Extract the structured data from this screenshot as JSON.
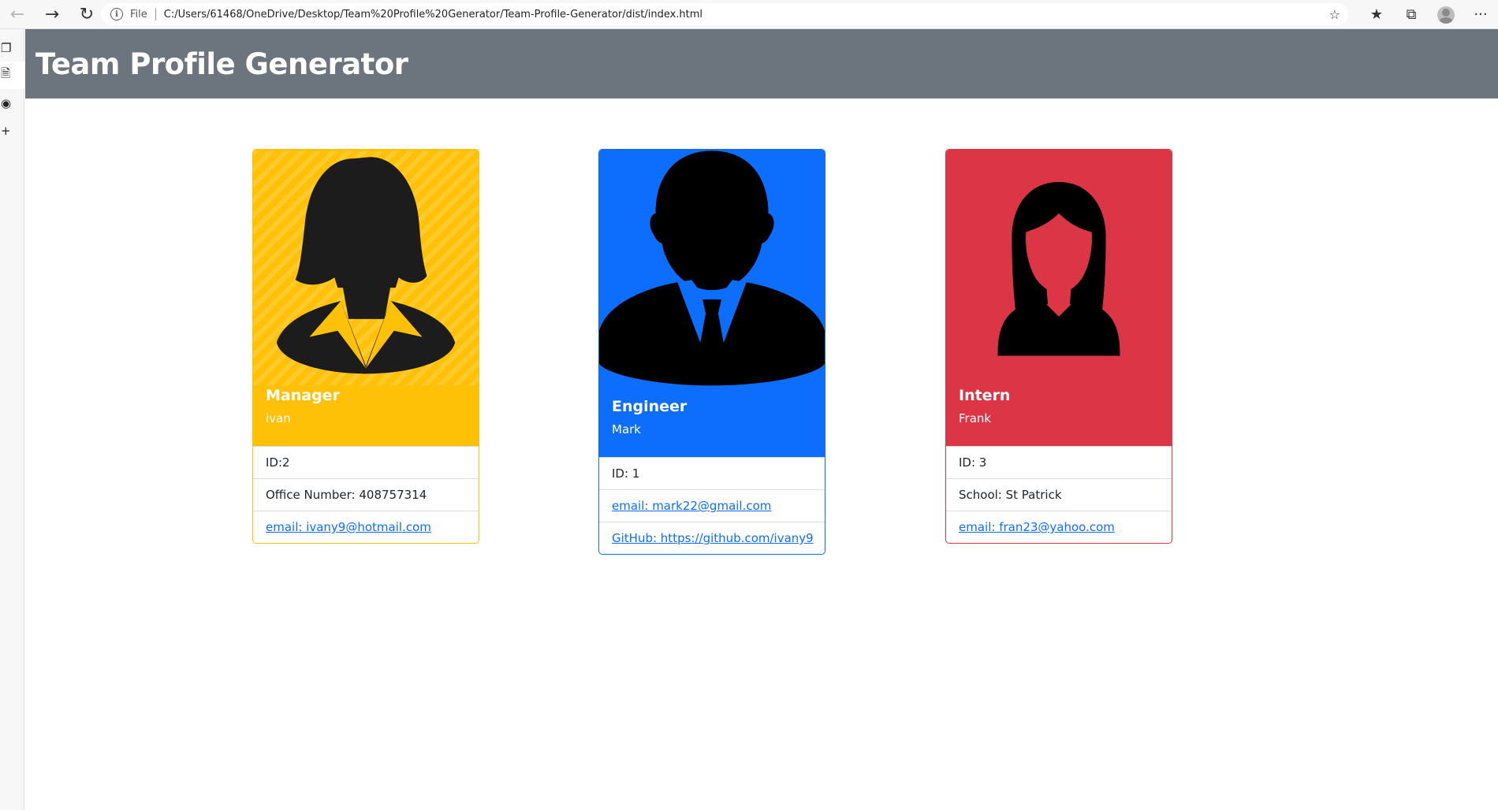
{
  "browser": {
    "file_label": "File",
    "url": "C:/Users/61468/OneDrive/Desktop/Team%20Profile%20Generator/Team-Profile-Generator/dist/index.html",
    "menu_glyph": "···"
  },
  "header": {
    "title": "Team Profile Generator"
  },
  "colors": {
    "manager": "#ffc107",
    "engineer": "#0d6efd",
    "intern": "#dc3545",
    "header": "#6c757d"
  },
  "cards": [
    {
      "role": "Manager",
      "name": "ivan",
      "icon": "woman-suit-avatar-icon",
      "items": [
        "ID:2",
        "Office Number: 408757314"
      ],
      "link": "email: ivany9@hotmail.com"
    },
    {
      "role": "Engineer",
      "name": "Mark",
      "icon": "man-suit-avatar-icon",
      "items": [
        "ID: 1"
      ],
      "link": "email: mark22@gmail.com",
      "link2": "GitHub: https://github.com/ivany9"
    },
    {
      "role": "Intern",
      "name": "Frank",
      "icon": "woman-long-hair-avatar-icon",
      "items": [
        "ID: 3",
        "School: St Patrick"
      ],
      "link": "email: fran23@yahoo.com"
    }
  ]
}
